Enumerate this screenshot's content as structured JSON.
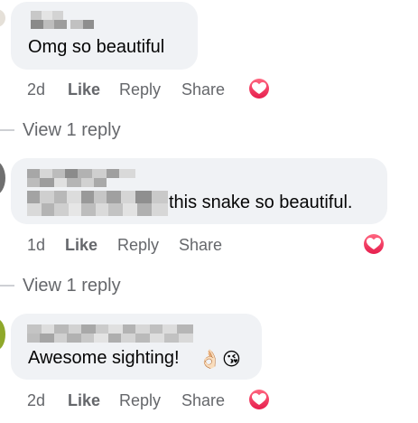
{
  "comments": [
    {
      "text": "Omg so beautiful",
      "time": "2d",
      "like": "Like",
      "reply": "Reply",
      "share": "Share",
      "reaction": "heart-reaction"
    },
    {
      "text": "this snake so beautiful.",
      "time": "1d",
      "like": "Like",
      "reply": "Reply",
      "share": "Share",
      "reaction": "heart-reaction"
    },
    {
      "text": "Awesome sighting!",
      "emojis": [
        "👌🏻",
        "😘"
      ],
      "time": "2d",
      "like": "Like",
      "reply": "Reply",
      "share": "Share",
      "reaction": "heart-reaction"
    }
  ],
  "view_replies": [
    "View 1 reply",
    "View 1 reply"
  ],
  "colors": {
    "bubble": "#f0f2f5",
    "meta_text": "#65676b",
    "reaction_red": "#e61e4d",
    "thread_line": "#ced0d4"
  }
}
